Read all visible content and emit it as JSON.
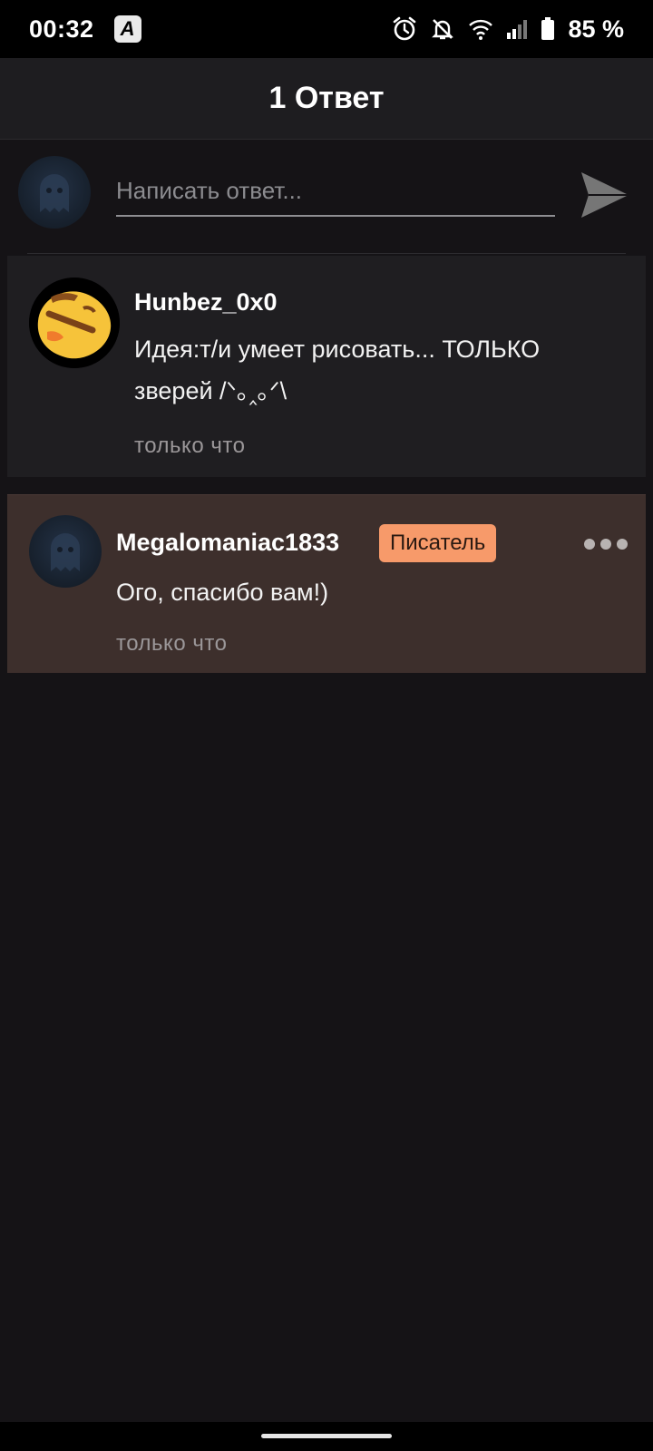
{
  "status": {
    "time": "00:32",
    "app_badge": "A",
    "battery": "85 %"
  },
  "header": {
    "title": "1 Ответ"
  },
  "compose": {
    "placeholder": "Написать ответ..."
  },
  "comments": [
    {
      "username": "Hunbez_0x0",
      "text": "Идея:т/и умеет рисовать... ТОЛЬКО зверей /ᐠ｡‸｡ᐟ\\",
      "timestamp": "только что"
    },
    {
      "username": "Megalomaniac1833",
      "badge": "Писатель",
      "text": "Ого, спасибо вам!)",
      "timestamp": "только что"
    }
  ],
  "colors": {
    "background": "#151316",
    "header": "#1e1d20",
    "comment_bg": "#1f1e21",
    "highlight_bg": "#3d2f2c",
    "badge": "#f79a6a"
  }
}
